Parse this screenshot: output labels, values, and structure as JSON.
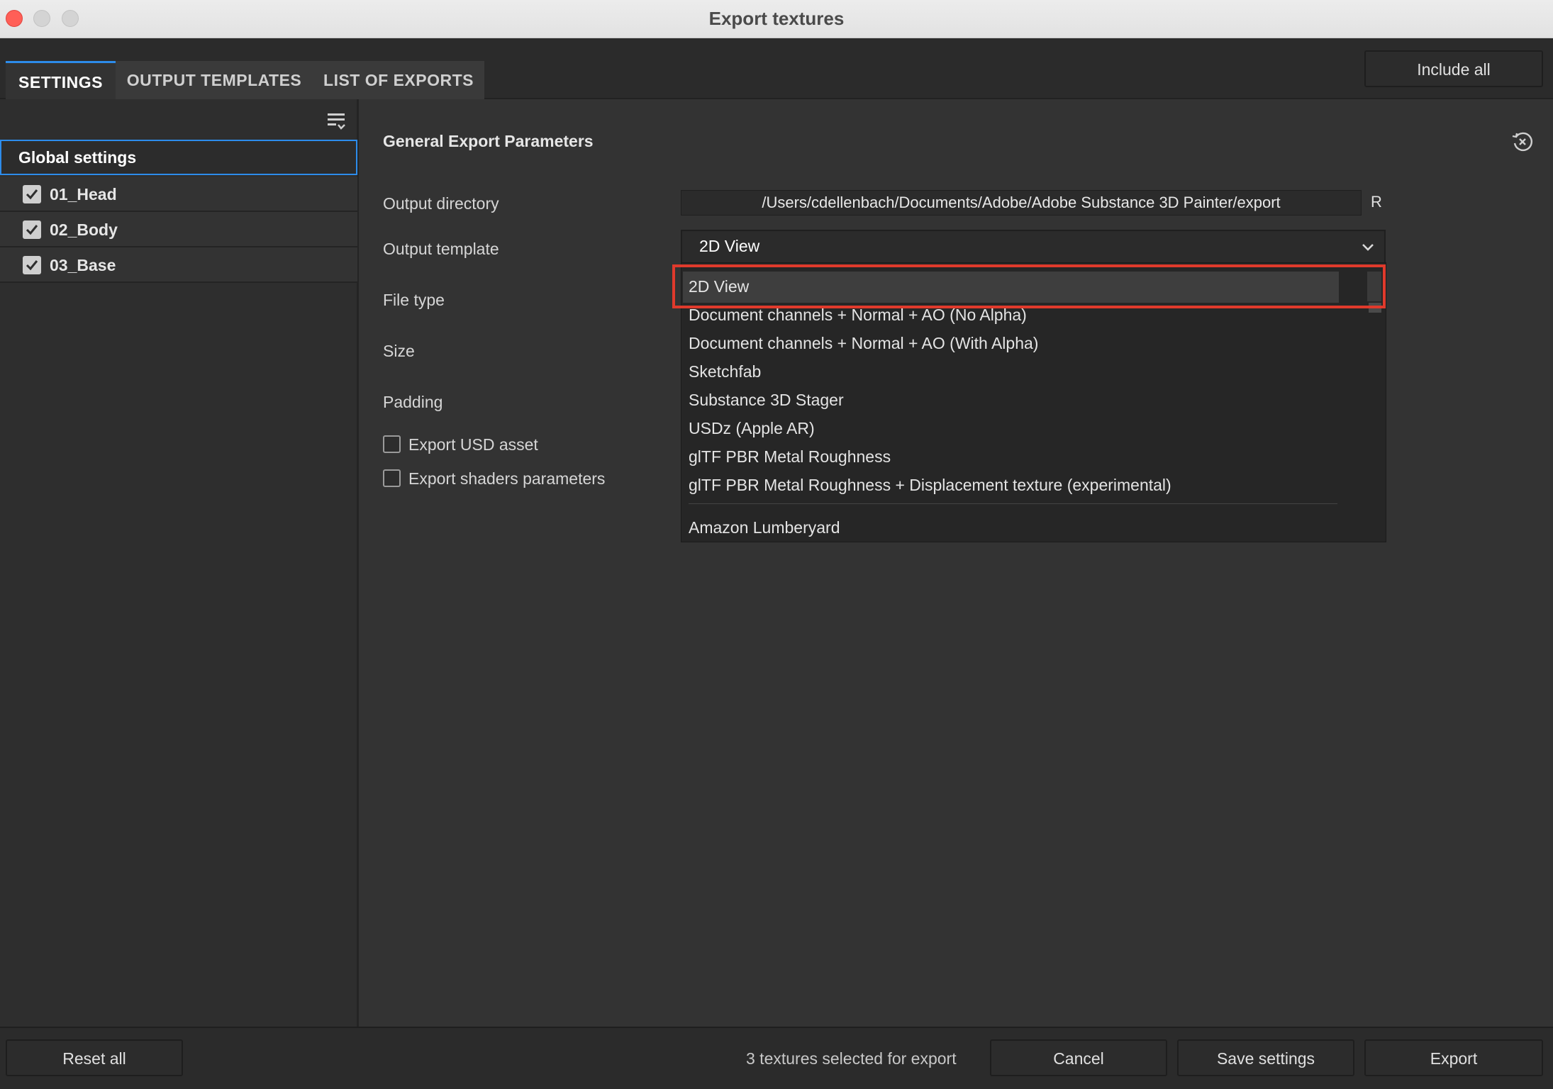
{
  "window": {
    "title": "Export textures"
  },
  "tabs": [
    {
      "label": "SETTINGS",
      "active": true
    },
    {
      "label": "OUTPUT TEMPLATES",
      "active": false
    },
    {
      "label": "LIST OF EXPORTS",
      "active": false
    }
  ],
  "header": {
    "include_all_label": "Include all"
  },
  "sidebar": {
    "global_label": "Global settings",
    "materials": [
      {
        "label": "01_Head",
        "checked": true
      },
      {
        "label": "02_Body",
        "checked": true
      },
      {
        "label": "03_Base",
        "checked": true
      }
    ]
  },
  "params": {
    "section_title": "General Export Parameters",
    "output_directory_label": "Output directory",
    "output_directory_value": "/Users/cdellenbach/Documents/Adobe/Adobe Substance 3D Painter/export",
    "output_directory_suffix": "R",
    "output_template_label": "Output template",
    "output_template_value": "2D View",
    "file_type_label": "File type",
    "size_label": "Size",
    "padding_label": "Padding",
    "export_usd_label": "Export USD asset",
    "export_shaders_label": "Export shaders parameters"
  },
  "dropdown": {
    "options": [
      "2D View",
      "Document channels + Normal + AO (No Alpha)",
      "Document channels + Normal + AO (With Alpha)",
      "Sketchfab",
      "Substance 3D Stager",
      "USDz (Apple AR)",
      "glTF PBR Metal Roughness",
      "glTF PBR Metal Roughness + Displacement texture (experimental)",
      "Amazon Lumberyard"
    ],
    "highlighted": "2D View"
  },
  "footer": {
    "reset_all_label": "Reset all",
    "status": "3 textures selected for export",
    "cancel_label": "Cancel",
    "save_label": "Save settings",
    "export_label": "Export"
  },
  "colors": {
    "accent": "#2d8ceb",
    "highlight_box": "#e03a2c",
    "close_button": "#ff5f57"
  }
}
